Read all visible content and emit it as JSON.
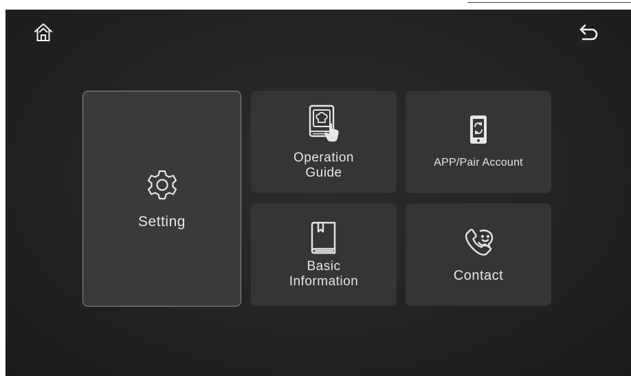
{
  "nav": {
    "home_icon": "home-icon",
    "back_icon": "back-arrow-icon"
  },
  "tiles": {
    "setting": {
      "label": "Setting",
      "icon": "gear-icon"
    },
    "operation_guide": {
      "line1": "Operation",
      "line2": "Guide",
      "icon": "recipe-book-touch-icon"
    },
    "app_pair": {
      "label": "APP/Pair Account",
      "icon": "phone-sync-icon"
    },
    "basic_information": {
      "line1": "Basic",
      "line2": "Information",
      "icon": "book-icon"
    },
    "contact": {
      "label": "Contact",
      "icon": "phone-support-icon"
    }
  },
  "colors": {
    "background": "#232323",
    "tile": "#353535",
    "text": "#e6e6e6",
    "selected_border": "#8a8a8a"
  }
}
